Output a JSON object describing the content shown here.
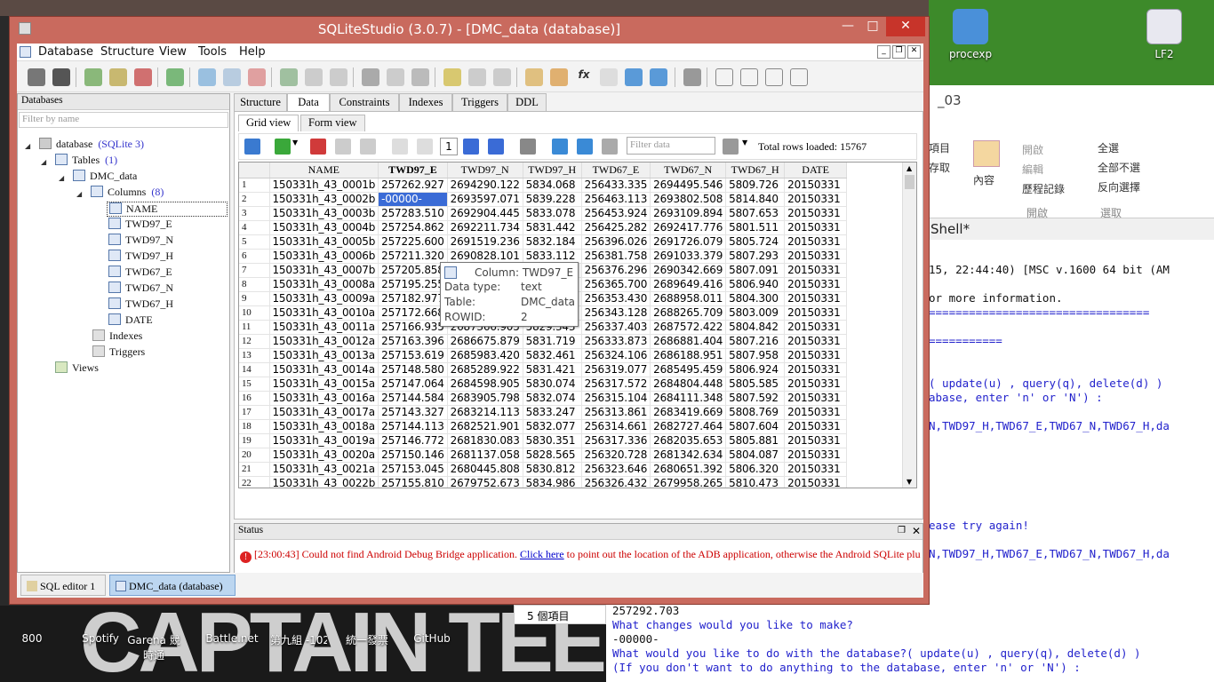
{
  "window": {
    "title": "SQLiteStudio (3.0.7) - [DMC_data (database)]"
  },
  "menu": [
    "Database",
    "Structure",
    "View",
    "Tools",
    "Help"
  ],
  "db_panel": {
    "header": "Databases",
    "filter_placeholder": "Filter by name",
    "database": {
      "label": "database",
      "type": "(SQLite 3)"
    },
    "tables": {
      "label": "Tables",
      "count": "(1)"
    },
    "table_name": "DMC_data",
    "columns": {
      "label": "Columns",
      "count": "(8)"
    },
    "column_items": [
      "NAME",
      "TWD97_E",
      "TWD97_N",
      "TWD97_H",
      "TWD67_E",
      "TWD67_N",
      "TWD67_H",
      "DATE"
    ],
    "indexes": "Indexes",
    "triggers": "Triggers",
    "views": "Views"
  },
  "tabs": [
    "Structure",
    "Data",
    "Constraints",
    "Indexes",
    "Triggers",
    "DDL"
  ],
  "subtabs": [
    "Grid view",
    "Form view"
  ],
  "grid_toolbar": {
    "page": "1",
    "filter_placeholder": "Filter data",
    "total_rows": "Total rows loaded: 15767"
  },
  "grid": {
    "columns": [
      "NAME",
      "TWD97_E",
      "TWD97_N",
      "TWD97_H",
      "TWD67_E",
      "TWD67_N",
      "TWD67_H",
      "DATE"
    ],
    "rows": [
      [
        "1",
        "150331h_43_0001b",
        "257262.927",
        "2694290.122",
        "5834.068",
        "256433.335",
        "2694495.546",
        "5809.726",
        "20150331"
      ],
      [
        "2",
        "150331h_43_0002b",
        "-00000-",
        "2693597.071",
        "5839.228",
        "256463.113",
        "2693802.508",
        "5814.840",
        "20150331"
      ],
      [
        "3",
        "150331h_43_0003b",
        "257283.510",
        "2692904.445",
        "5833.078",
        "256453.924",
        "2693109.894",
        "5807.653",
        "20150331"
      ],
      [
        "4",
        "150331h_43_0004b",
        "257254.862",
        "2692211.734",
        "5831.442",
        "256425.282",
        "2692417.776",
        "5801.511",
        "20150331"
      ],
      [
        "5",
        "150331h_43_0005b",
        "257225.600",
        "2691519.236",
        "5832.184",
        "256396.026",
        "2691726.079",
        "5805.724",
        "20150331"
      ],
      [
        "6",
        "150331h_43_0006b",
        "257211.320",
        "2690828.101",
        "5833.112",
        "256381.758",
        "2691033.379",
        "5807.293",
        "20150331"
      ],
      [
        "7",
        "150331h_43_0007b",
        "257205.858",
        "2690135.442",
        "5832.301",
        "256376.296",
        "2690342.669",
        "5807.091",
        "20150331"
      ],
      [
        "8",
        "150331h_43_0008a",
        "257195.255",
        "2689443.921",
        "5831.442",
        "256365.700",
        "2689649.416",
        "5806.940",
        "20150331"
      ],
      [
        "9",
        "150331h_43_0009a",
        "257182.977",
        "2688752.508",
        "5828.801",
        "256353.430",
        "2688958.011",
        "5804.300",
        "20150331"
      ],
      [
        "10",
        "150331h_43_0010a",
        "257172.668",
        "2688060.199",
        "5827.509",
        "256343.128",
        "2688265.709",
        "5803.009",
        "20150331"
      ],
      [
        "11",
        "150331h_43_0011a",
        "257166.935",
        "2687366.905",
        "5829.343",
        "256337.403",
        "2687572.422",
        "5804.842",
        "20150331"
      ],
      [
        "12",
        "150331h_43_0012a",
        "257163.396",
        "2686675.879",
        "5831.719",
        "256333.873",
        "2686881.404",
        "5807.216",
        "20150331"
      ],
      [
        "13",
        "150331h_43_0013a",
        "257153.619",
        "2685983.420",
        "5832.461",
        "256324.106",
        "2686188.951",
        "5807.958",
        "20150331"
      ],
      [
        "14",
        "150331h_43_0014a",
        "257148.580",
        "2685289.922",
        "5831.421",
        "256319.077",
        "2685495.459",
        "5806.924",
        "20150331"
      ],
      [
        "15",
        "150331h_43_0015a",
        "257147.064",
        "2684598.905",
        "5830.074",
        "256317.572",
        "2684804.448",
        "5805.585",
        "20150331"
      ],
      [
        "16",
        "150331h_43_0016a",
        "257144.584",
        "2683905.798",
        "5832.074",
        "256315.104",
        "2684111.348",
        "5807.592",
        "20150331"
      ],
      [
        "17",
        "150331h_43_0017a",
        "257143.327",
        "2683214.113",
        "5833.247",
        "256313.861",
        "2683419.669",
        "5808.769",
        "20150331"
      ],
      [
        "18",
        "150331h_43_0018a",
        "257144.113",
        "2682521.901",
        "5832.077",
        "256314.661",
        "2682727.464",
        "5807.604",
        "20150331"
      ],
      [
        "19",
        "150331h_43_0019a",
        "257146.772",
        "2681830.083",
        "5830.351",
        "256317.336",
        "2682035.653",
        "5805.881",
        "20150331"
      ],
      [
        "20",
        "150331h_43_0020a",
        "257150.146",
        "2681137.058",
        "5828.565",
        "256320.728",
        "2681342.634",
        "5804.087",
        "20150331"
      ],
      [
        "21",
        "150331h_43_0021a",
        "257153.045",
        "2680445.808",
        "5830.812",
        "256323.646",
        "2680651.392",
        "5806.320",
        "20150331"
      ],
      [
        "22",
        "150331h_43_0022b",
        "257155.810",
        "2679752.673",
        "5834.986",
        "256326.432",
        "2679958.265",
        "5810.473",
        "20150331"
      ]
    ]
  },
  "tooltip": {
    "column": "Column: TWD97_E",
    "datatype_label": "Data type:",
    "datatype": "text",
    "table_label": "Table:",
    "table": "DMC_data",
    "rowid_label": "ROWID:",
    "rowid": "2"
  },
  "status": {
    "header": "Status",
    "time": "[23:00:43]",
    "msg1": "Could not find Android Debug Bridge application.",
    "link": "Click here",
    "msg2": "to point out the location of the ADB application, otherwise the Android SQLite plugi"
  },
  "task_tabs": [
    "SQL editor 1",
    "DMC_data (database)"
  ],
  "desktop": {
    "right_icons": [
      "procexp",
      "LF2"
    ],
    "bottom_icons": [
      "800",
      "Spotify",
      "Garena 競時通",
      "Battle.net",
      "第九組 -1023060...",
      "統一發票",
      "GitHub"
    ]
  },
  "ribbon": {
    "title_fragment": "_03",
    "open": "開啟",
    "edit": "編輯",
    "history": "歷程記錄",
    "select_all": "全選",
    "select_none": "全部不選",
    "invert": "反向選擇",
    "group_open": "開啟",
    "group_select": "選取",
    "prop": "內容",
    "item_a": "項目",
    "item_b": "存取",
    "count": "5 個項目"
  },
  "shell": {
    "title": "Shell*",
    "lines": [
      "15, 22:44:40) [MSC v.1600 64 bit (AM",
      "or more information.",
      "=================================",
      "===========",
      "( update(u) , query(q), delete(d) )",
      "abase, enter 'n' or 'N') :",
      "N,TWD97_H,TWD67_E,TWD67_N,TWD67_H,da",
      "ease try again!",
      "N,TWD97_H,TWD67_E,TWD67_N,TWD67_H,da"
    ],
    "bottom_lines": [
      "257292.703",
      "What changes would you like to make?",
      "-00000-",
      "What would you like to do with the database?( update(u) , query(q), delete(d) )",
      "(If you don't want to do anything to the database, enter 'n' or 'N') :"
    ]
  }
}
